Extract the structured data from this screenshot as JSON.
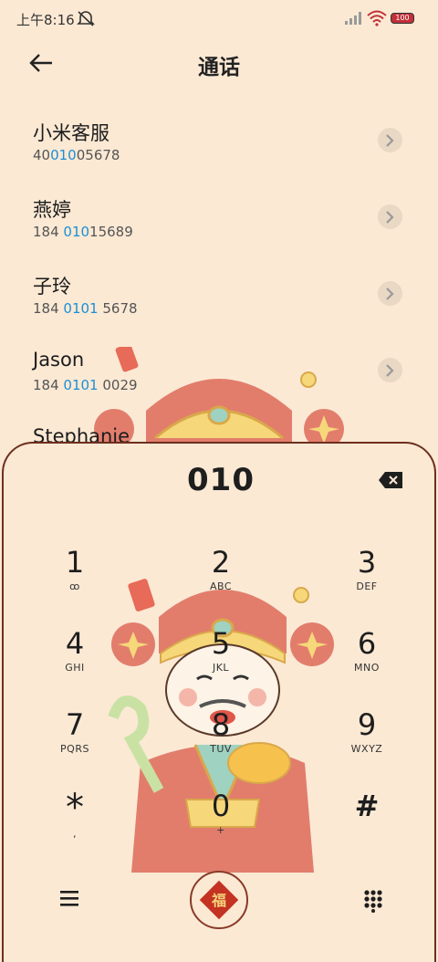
{
  "status_bar": {
    "time": "上午8:16",
    "battery": "100",
    "icons": [
      "mute-icon",
      "signal-icon",
      "wifi-icon",
      "battery-icon"
    ]
  },
  "header": {
    "title": "通话",
    "back_icon": "back-arrow-icon"
  },
  "contacts": [
    {
      "name": "小米客服",
      "number_pre": "40",
      "number_hl": "010",
      "number_post": "05678"
    },
    {
      "name": "燕婷",
      "number_pre": "184 ",
      "number_hl": "010",
      "number_post": "15689"
    },
    {
      "name": "子玲",
      "number_pre": "184 ",
      "number_hl": "0101",
      "number_post": " 5678"
    },
    {
      "name": "Jason",
      "number_pre": "184 ",
      "number_hl": "0101",
      "number_post": " 0029"
    },
    {
      "name": "Stephanie",
      "number_pre": "",
      "number_hl": "",
      "number_post": ""
    }
  ],
  "dialpad": {
    "dialed": "010",
    "keys": [
      {
        "digit": "1",
        "letters": "ꝏ"
      },
      {
        "digit": "2",
        "letters": "ABC"
      },
      {
        "digit": "3",
        "letters": "DEF"
      },
      {
        "digit": "4",
        "letters": "GHI"
      },
      {
        "digit": "5",
        "letters": "JKL"
      },
      {
        "digit": "6",
        "letters": "MNO"
      },
      {
        "digit": "7",
        "letters": "PQRS"
      },
      {
        "digit": "8",
        "letters": "TUV"
      },
      {
        "digit": "9",
        "letters": "WXYZ"
      },
      {
        "digit": "*",
        "letters": ","
      },
      {
        "digit": "0",
        "letters": "+"
      },
      {
        "digit": "#",
        "letters": ""
      }
    ],
    "call_label": "福",
    "colors": {
      "accent": "#1a8fd6",
      "panel_border": "#6e2e1e",
      "call_red": "#c43221"
    }
  }
}
